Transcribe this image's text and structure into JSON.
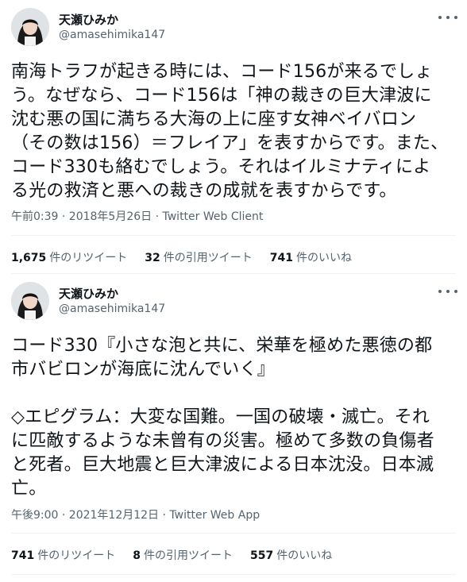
{
  "tweets": [
    {
      "name": "天瀬ひみか",
      "handle": "@amasehimika147",
      "text": "南海トラフが起きる時には、コード156が来るでしょ\nう。なぜなら、コード156は「神の裁きの巨大津波に\n沈む悪の国に満ちる大海の上に座す女神ベイバロン\n（その数は156）＝フレイア」を表すからです。また、\nコード330も絡むでしょう。それはイルミナティによ\nる光の救済と悪への裁きの成就を表すからです。",
      "meta": "午前0:39 · 2018年5月26日 · Twitter Web Client",
      "retweets_count": "1,675",
      "retweets_label": "件のリツイート",
      "quotes_count": "32",
      "quotes_label": "件の引用ツイート",
      "likes_count": "741",
      "likes_label": "件のいいね"
    },
    {
      "name": "天瀬ひみか",
      "handle": "@amasehimika147",
      "text": "コード330『小さな泡と共に、栄華を極めた悪徳の都\n市バビロンが海底に沈んでいく』\n\n◇エピグラム：大変な国難。一国の破壊・滅亡。それ\nに匹敵するような未曾有の災害。極めて多数の負傷者\nと死者。巨大地震と巨大津波による日本沈没。日本滅\n亡。",
      "meta": "午後9:00 · 2021年12月12日 · Twitter Web App",
      "retweets_count": "741",
      "retweets_label": "件のリツイート",
      "quotes_count": "8",
      "quotes_label": "件の引用ツイート",
      "likes_count": "557",
      "likes_label": "件のいいね"
    }
  ],
  "icons": {
    "avatar": "user-avatar",
    "more": "more-options-icon"
  }
}
